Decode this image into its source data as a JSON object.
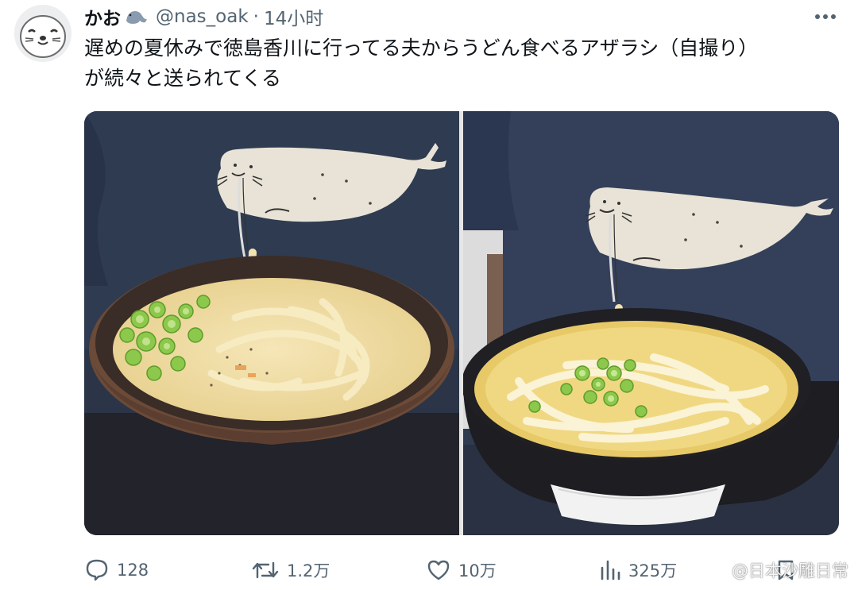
{
  "author": {
    "display_name": "かお",
    "handle": "@nas_oak",
    "separator": "·",
    "time": "14小时"
  },
  "tweet": {
    "text": "遅めの夏休みで徳島香川に行ってる夫からうどん食べるアザラシ（自撮り）\nが続々と送られてくる"
  },
  "media": {
    "photos": [
      {
        "description_icon": "seal-tshirt-udon-bowl-wooden"
      },
      {
        "description_icon": "seal-tshirt-udon-bowl-black"
      }
    ]
  },
  "actions": {
    "replies": "128",
    "retweets": "1.2万",
    "likes": "10万",
    "views": "325万"
  },
  "watermark": {
    "text": "@日本沙雕日常"
  },
  "colors": {
    "text_primary": "#0f1419",
    "text_secondary": "#536471",
    "shirt": "#2f3a4d",
    "seal": "#e9e4d8",
    "noodle": "#f3e2ac",
    "scallion": "#7fbf3a"
  }
}
